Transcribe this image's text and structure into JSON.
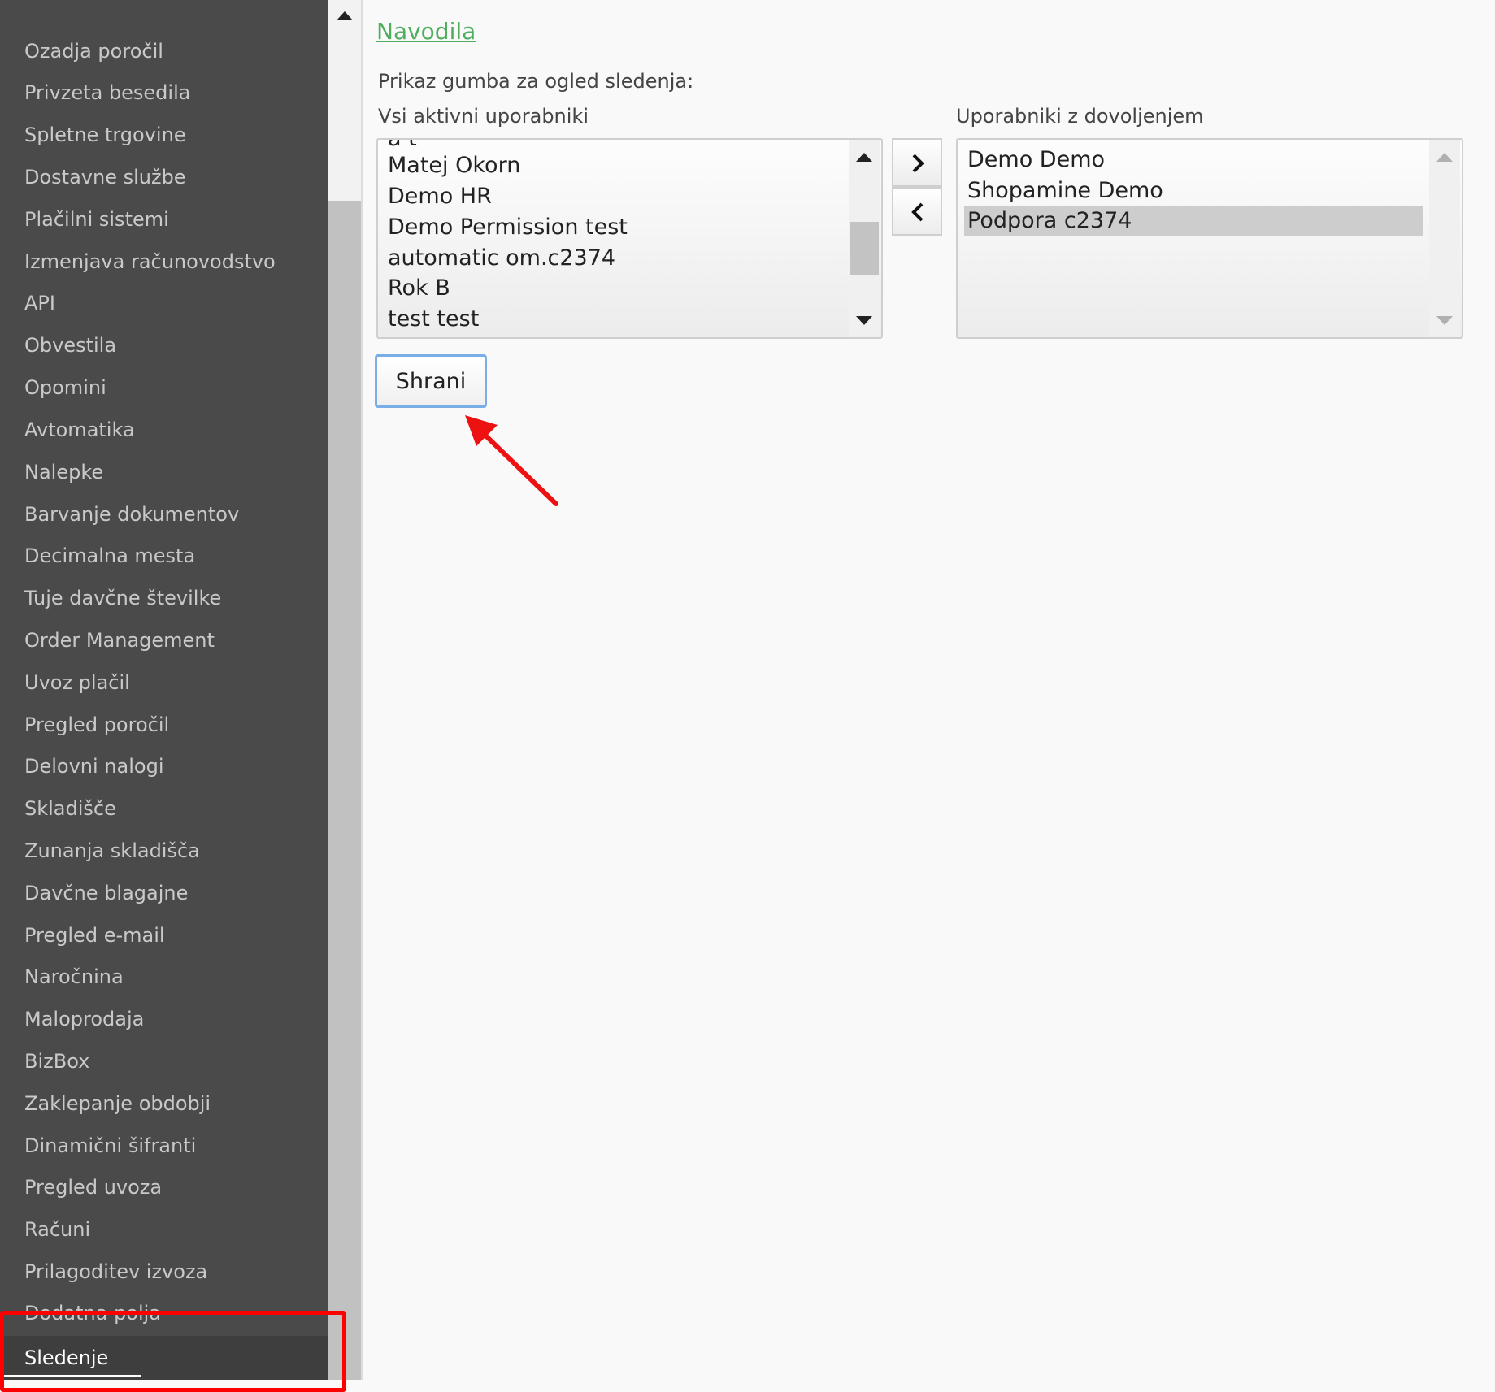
{
  "sidebar": {
    "items": [
      {
        "label": "Ozadja poročil"
      },
      {
        "label": "Privzeta besedila"
      },
      {
        "label": "Spletne trgovine"
      },
      {
        "label": "Dostavne službe"
      },
      {
        "label": "Plačilni sistemi"
      },
      {
        "label": "Izmenjava računovodstvo"
      },
      {
        "label": "API"
      },
      {
        "label": "Obvestila"
      },
      {
        "label": "Opomini"
      },
      {
        "label": "Avtomatika"
      },
      {
        "label": "Nalepke"
      },
      {
        "label": "Barvanje dokumentov"
      },
      {
        "label": "Decimalna mesta"
      },
      {
        "label": "Tuje davčne številke"
      },
      {
        "label": "Order Management"
      },
      {
        "label": "Uvoz plačil"
      },
      {
        "label": "Pregled poročil"
      },
      {
        "label": "Delovni nalogi"
      },
      {
        "label": "Skladišče"
      },
      {
        "label": "Zunanja skladišča"
      },
      {
        "label": "Davčne blagajne"
      },
      {
        "label": "Pregled e-mail"
      },
      {
        "label": "Naročnina"
      },
      {
        "label": "Maloprodaja"
      },
      {
        "label": "BizBox"
      },
      {
        "label": "Zaklepanje obdobji"
      },
      {
        "label": "Dinamični šifranti"
      },
      {
        "label": "Pregled uvoza"
      },
      {
        "label": "Računi"
      },
      {
        "label": "Prilagoditev izvoza"
      }
    ],
    "partial_item": "Dodatna polja",
    "active_item": "Sledenje"
  },
  "main": {
    "help_link": "Navodila",
    "section_label": "Prikaz gumba za ogled sledenja:",
    "left_list": {
      "label": "Vsi aktivni uporabniki",
      "clipped_item": "a t",
      "items": [
        "Matej Okorn",
        "Demo HR",
        "Demo Permission test",
        "automatic om.c2374",
        "Rok B",
        "test test"
      ]
    },
    "right_list": {
      "label": "Uporabniki z dovoljenjem",
      "items": [
        "Demo Demo",
        "Shopamine Demo",
        "Podpora c2374"
      ],
      "selected": "Podpora c2374"
    },
    "save_label": "Shrani"
  },
  "colors": {
    "sidebar_bg": "#4a4a4a",
    "link_green": "#4fae5d",
    "highlight_red": "#ff0000",
    "button_focus": "#79aee6"
  },
  "icons": {
    "move_right": "chevron-right-icon",
    "move_left": "chevron-left-icon"
  }
}
